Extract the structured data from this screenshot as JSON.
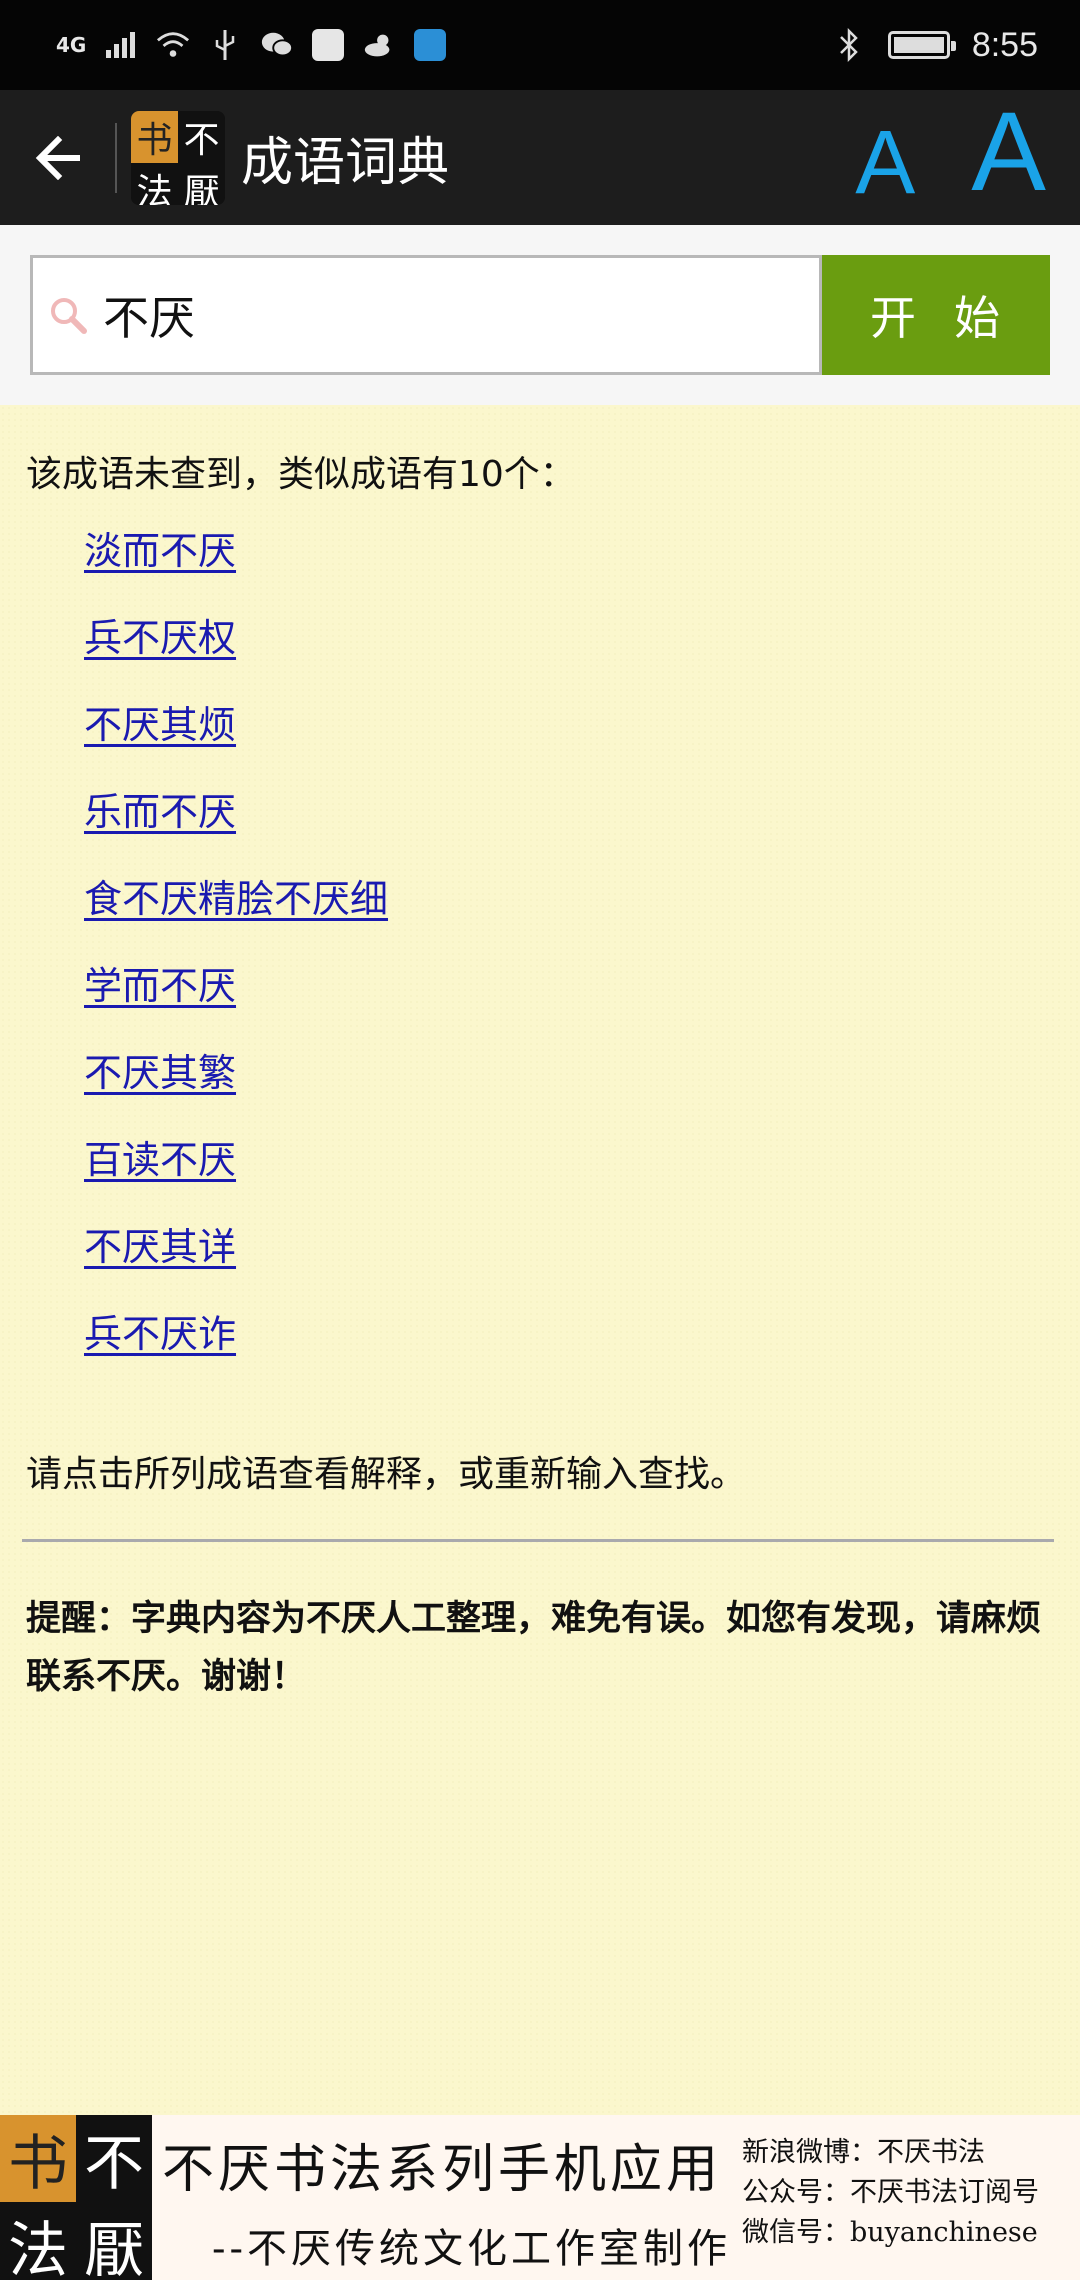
{
  "status_bar": {
    "network": "4G",
    "time": "8:55"
  },
  "app_bar": {
    "title": "成语词典",
    "logo_chars": [
      "书",
      "不",
      "法",
      "厭"
    ],
    "font_small_label": "A",
    "font_large_label": "A"
  },
  "search": {
    "value": "不厌",
    "button_label": "开始"
  },
  "results": {
    "message": "该成语未查到，类似成语有10个：",
    "idioms": [
      "淡而不厌",
      "兵不厌权",
      "不厌其烦",
      "乐而不厌",
      "食不厌精脍不厌细",
      "学而不厌",
      "不厌其繁",
      "百读不厌",
      "不厌其详",
      "兵不厌诈"
    ],
    "instruction": "请点击所列成语查看解释，或重新输入查找。",
    "notice": "提醒：字典内容为不厌人工整理，难免有误。如您有发现，请麻烦联系不厌。谢谢！"
  },
  "banner": {
    "logo_chars": [
      "书",
      "不",
      "法",
      "厭"
    ],
    "title": "不厌书法系列手机应用",
    "subtitle": "--不厌传统文化工作室制作",
    "info": [
      "新浪微博：不厌书法",
      "公众号：不厌书法订阅号",
      "微信号：buyanchinese"
    ]
  },
  "colors": {
    "start_button": "#6a9d10",
    "link": "#1a1ab0",
    "font_size_icons": "#1aa3e8",
    "content_bg": "#fbf7cd"
  }
}
